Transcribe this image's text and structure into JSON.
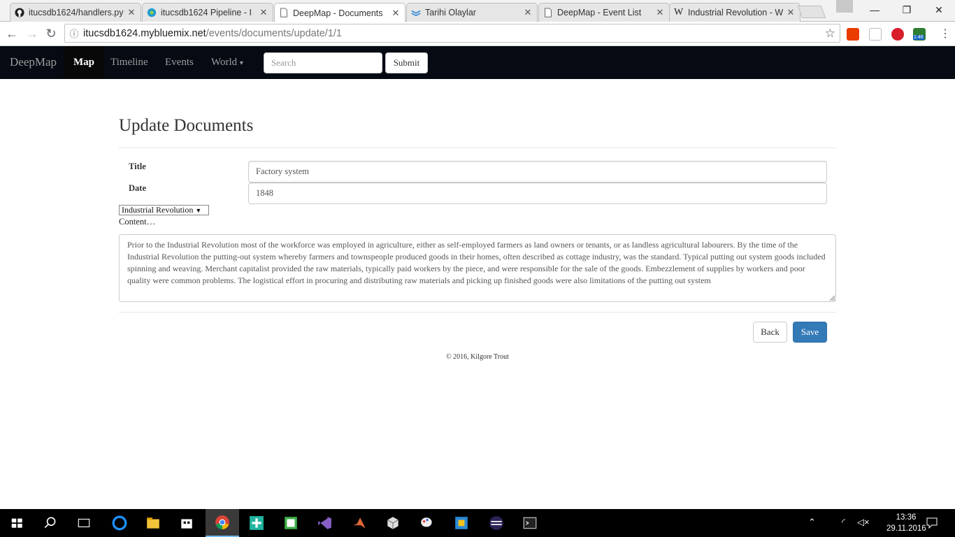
{
  "browser": {
    "tabs": [
      {
        "title": "itucsdb1624/handlers.py",
        "icon": "github-icon",
        "active": false
      },
      {
        "title": "itucsdb1624 Pipeline - I",
        "icon": "pipeline-icon",
        "active": false
      },
      {
        "title": "DeepMap - Documents",
        "icon": "page-icon",
        "active": true
      },
      {
        "title": "Tarihi Olaylar",
        "icon": "bluemix-icon",
        "active": false
      },
      {
        "title": "DeepMap - Event List",
        "icon": "page-icon",
        "active": false
      },
      {
        "title": "Industrial Revolution - W",
        "icon": "wikipedia-icon",
        "active": false
      }
    ],
    "url_host": "itucsdb1624.mybluemix.net",
    "url_path": "/events/documents/update/1/1",
    "extension_badge": "1:46"
  },
  "navbar": {
    "brand": "DeepMap",
    "links": [
      "Map",
      "Timeline",
      "Events",
      "World"
    ],
    "dropdown_caret": "▾",
    "search_placeholder": "Search",
    "submit_label": "Submit"
  },
  "form": {
    "heading": "Update Documents",
    "title_label": "Title",
    "title_value": "Factory system",
    "date_label": "Date",
    "date_value": "1848",
    "era_selected": "Industrial Revolution",
    "content_label": "Content…",
    "content_text": "Prior to the Industrial Revolution most of the workforce was employed in agriculture, either as self-employed farmers as land owners or tenants, or as landless agricultural labourers. By the time of the Industrial Revolution the putting-out system whereby farmers and townspeople produced goods in their homes, often described as cottage industry, was the standard. Typical putting out system goods included spinning and weaving. Merchant capitalist provided the raw materials, typically paid workers by the piece, and were responsible for the sale of the goods. Embezzlement of supplies by workers and poor quality were common problems. The logistical effort in procuring and distributing raw materials and picking up finished goods were also limitations of the putting out system",
    "back_label": "Back",
    "save_label": "Save"
  },
  "footer": {
    "text": "© 2016, Kilgore Trout"
  },
  "taskbar": {
    "time": "13:36",
    "date": "29.11.2016",
    "language": "",
    "icons": [
      "windows-start-icon",
      "search-icon",
      "task-view-icon",
      "edge-icon",
      "file-explorer-icon",
      "store-icon",
      "chrome-icon",
      "plus-app-icon",
      "photo-app-icon",
      "visual-studio-icon",
      "matlab-icon",
      "cube-app-icon",
      "paint-icon",
      "box-app-icon",
      "eclipse-icon",
      "terminal-icon"
    ]
  },
  "colors": {
    "navbar_bg": "#050a13",
    "save_button": "#337ab7",
    "taskbar": "#000000"
  }
}
